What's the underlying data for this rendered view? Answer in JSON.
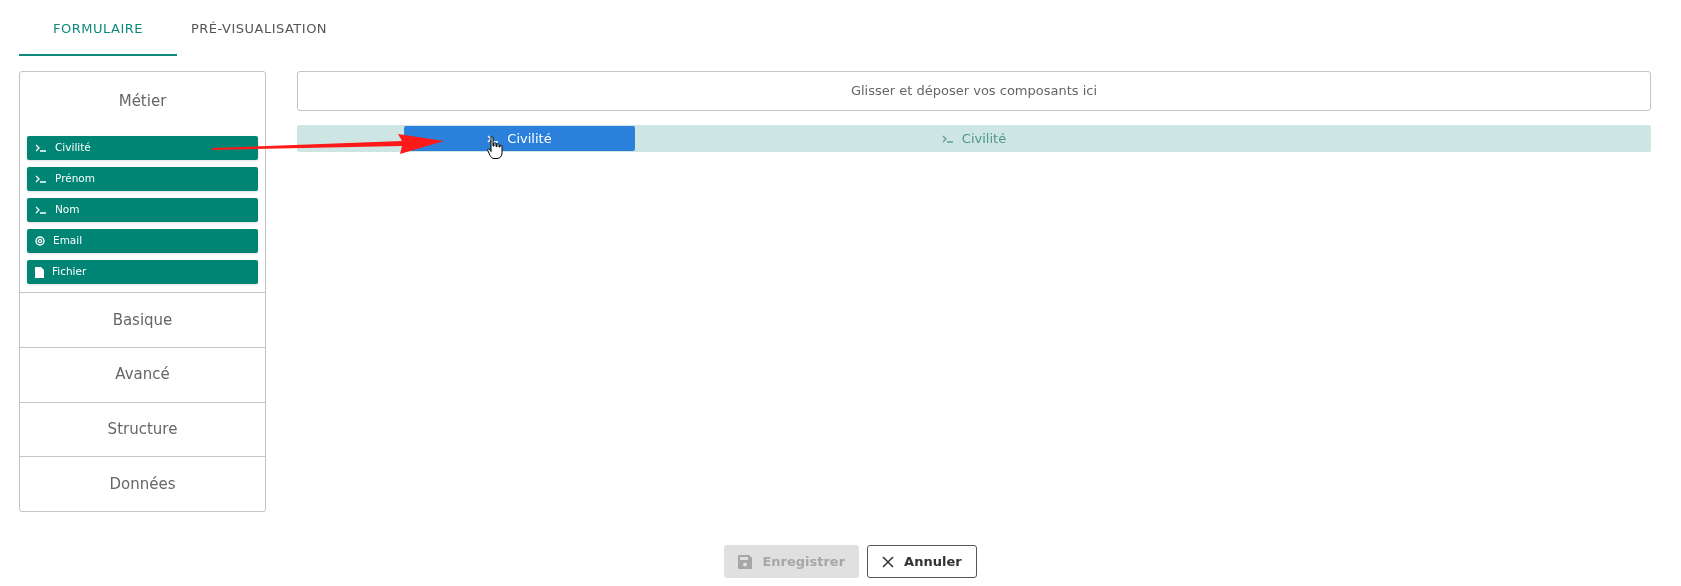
{
  "tabs": [
    {
      "label": "FORMULAIRE",
      "selected": true
    },
    {
      "label": "PRÉ-VISUALISATION",
      "selected": false
    }
  ],
  "palette": {
    "sections": [
      {
        "title": "Métier",
        "expanded": true,
        "items": [
          {
            "label": "Civilité",
            "kind": "text"
          },
          {
            "label": "Prénom",
            "kind": "text"
          },
          {
            "label": "Nom",
            "kind": "text"
          },
          {
            "label": "Email",
            "kind": "email"
          },
          {
            "label": "Fichier",
            "kind": "file"
          }
        ]
      },
      {
        "title": "Basique",
        "expanded": false
      },
      {
        "title": "Avancé",
        "expanded": false
      },
      {
        "title": "Structure",
        "expanded": false
      },
      {
        "title": "Données",
        "expanded": false
      }
    ]
  },
  "dropzone": {
    "hint": "Glisser et déposer vos composants ici"
  },
  "drop_preview": {
    "label": "Civilité",
    "kind": "text"
  },
  "dragged_item": {
    "label": "Civilité",
    "kind": "text"
  },
  "buttons": [
    {
      "label": "Enregistrer",
      "kind": "save",
      "disabled": true
    },
    {
      "label": "Annuler",
      "kind": "cancel",
      "disabled": false
    }
  ]
}
